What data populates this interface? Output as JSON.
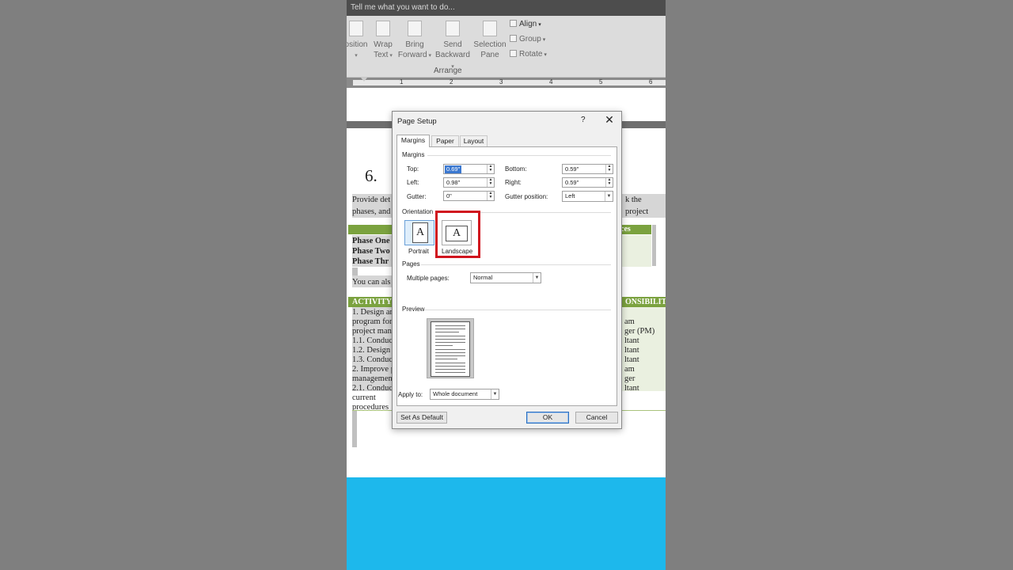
{
  "tellme": {
    "text": "Tell me what you want to do..."
  },
  "ribbon": {
    "position_label": "osition",
    "wrap_line1": "Wrap",
    "wrap_line2": "Text",
    "bring_line1": "Bring",
    "bring_line2": "Forward",
    "send_line1": "Send",
    "send_line2": "Backward",
    "selection_line1": "Selection",
    "selection_line2": "Pane",
    "align": "Align",
    "group": "Group",
    "rotate": "Rotate",
    "group_label": "Arrange"
  },
  "ruler": {
    "n1": "1",
    "n2": "2",
    "n3": "3",
    "n4": "4",
    "n5": "5",
    "n6": "6"
  },
  "doc": {
    "heading": "6.",
    "para1_left": "Provide det",
    "para1_right": "k the project",
    "para2_left": "phases, and",
    "table1_header_right": "ces",
    "phase1": "Phase One",
    "phase2": "Phase Two",
    "phase3": "Phase Thr",
    "para3": "You can als",
    "table2_header_left": "ACTIVITY",
    "table2_header_right": "ONSIBILITY",
    "rows_left": [
      "1. Design an",
      "program for",
      "project man",
      "1.1. Conduct",
      "1.2. Design t",
      "1.3. Conduct",
      "2. Improve p",
      "managemen",
      "2.1. Conduct",
      "current",
      "procedures"
    ],
    "rows_right": [
      "am",
      "ger (PM)",
      "ltant",
      "ltant",
      "ltant",
      "am",
      "ger",
      "ltant"
    ]
  },
  "dialog": {
    "title": "Page Setup",
    "help": "?",
    "close": "✕",
    "tabs": [
      "Margins",
      "Paper",
      "Layout"
    ],
    "margins_section": "Margins",
    "top_label": "Top:",
    "top_value": "0.69\"",
    "bottom_label": "Bottom:",
    "bottom_value": "0.59\"",
    "left_label": "Left:",
    "left_value": "0.98\"",
    "right_label": "Right:",
    "right_value": "0.59\"",
    "gutter_label": "Gutter:",
    "gutter_value": "0\"",
    "gutter_pos_label": "Gutter position:",
    "gutter_pos_value": "Left",
    "orientation_section": "Orientation",
    "portrait": "Portrait",
    "landscape": "Landscape",
    "pages_section": "Pages",
    "multiple_pages_label": "Multiple pages:",
    "multiple_pages_value": "Normal",
    "preview_section": "Preview",
    "apply_to_label": "Apply to:",
    "apply_to_value": "Whole document",
    "set_default": "Set As Default",
    "ok": "OK",
    "cancel": "Cancel",
    "highlight_color": "#d0141e"
  }
}
